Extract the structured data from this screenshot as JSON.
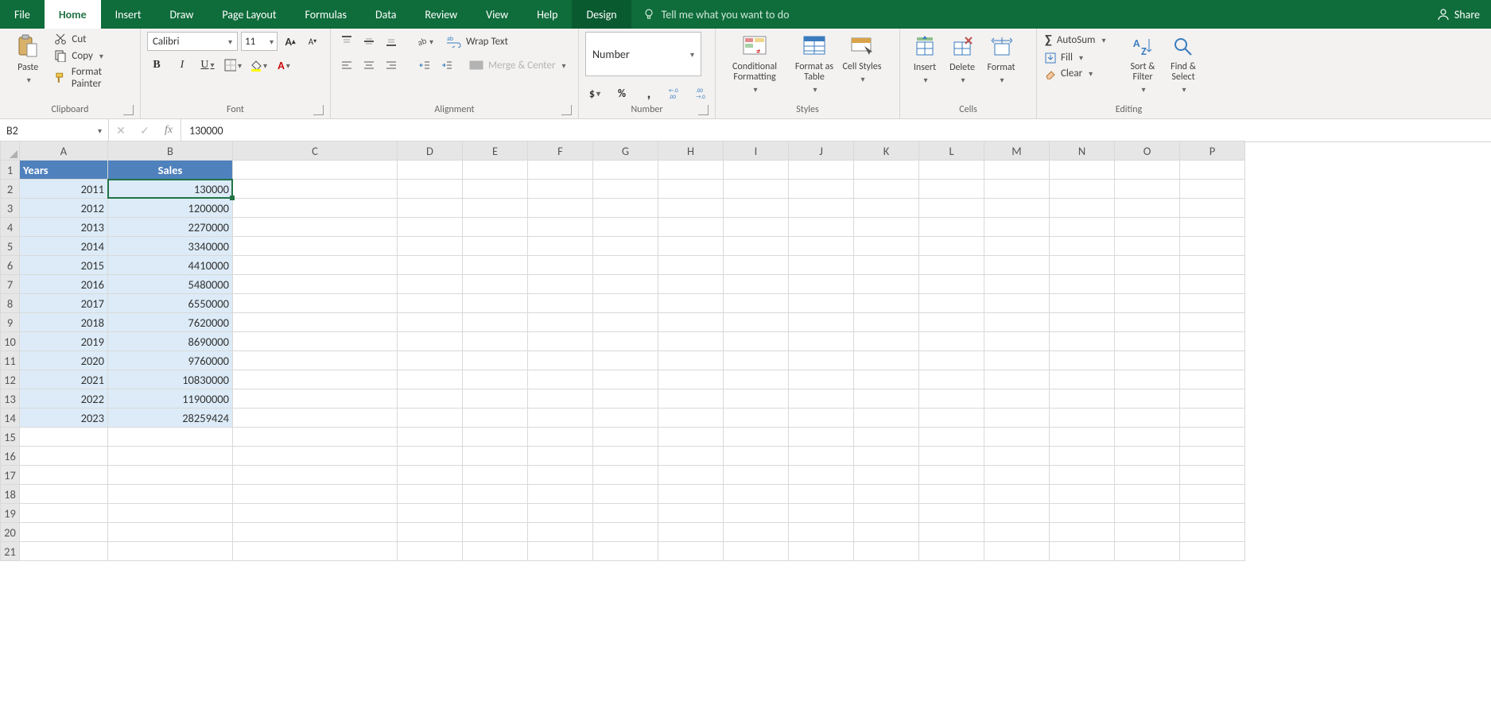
{
  "tabs": {
    "file": "File",
    "home": "Home",
    "insert": "Insert",
    "draw": "Draw",
    "page_layout": "Page Layout",
    "formulas": "Formulas",
    "data": "Data",
    "review": "Review",
    "view": "View",
    "help": "Help",
    "design": "Design"
  },
  "tellme": "Tell me what you want to do",
  "share": "Share",
  "ribbon": {
    "clipboard": {
      "title": "Clipboard",
      "paste": "Paste",
      "cut": "Cut",
      "copy": "Copy",
      "format_painter": "Format Painter"
    },
    "font": {
      "title": "Font",
      "name": "Calibri",
      "size": "11",
      "bold": "B",
      "italic": "I",
      "underline": "U"
    },
    "alignment": {
      "title": "Alignment",
      "wrap": "Wrap Text",
      "merge": "Merge & Center"
    },
    "number": {
      "title": "Number",
      "format": "Number",
      "currency": "$",
      "percent": "%",
      "comma": ",",
      "inc": "+.0",
      "dec": ".00"
    },
    "styles": {
      "title": "Styles",
      "cond": "Conditional Formatting",
      "table": "Format as Table",
      "cell": "Cell Styles"
    },
    "cells": {
      "title": "Cells",
      "insert": "Insert",
      "delete": "Delete",
      "format": "Format"
    },
    "editing": {
      "title": "Editing",
      "autosum": "AutoSum",
      "fill": "Fill",
      "clear": "Clear",
      "sort": "Sort & Filter",
      "find": "Find & Select"
    }
  },
  "formula_bar": {
    "cell_ref": "B2",
    "value": "130000"
  },
  "columns": [
    "A",
    "B",
    "C",
    "D",
    "E",
    "F",
    "G",
    "H",
    "I",
    "J",
    "K",
    "L",
    "M",
    "N",
    "O",
    "P"
  ],
  "row_count": 21,
  "headers": {
    "A": "Years",
    "B": "Sales"
  },
  "data_rows": [
    {
      "year": "2011",
      "sales": "130000"
    },
    {
      "year": "2012",
      "sales": "1200000"
    },
    {
      "year": "2013",
      "sales": "2270000"
    },
    {
      "year": "2014",
      "sales": "3340000"
    },
    {
      "year": "2015",
      "sales": "4410000"
    },
    {
      "year": "2016",
      "sales": "5480000"
    },
    {
      "year": "2017",
      "sales": "6550000"
    },
    {
      "year": "2018",
      "sales": "7620000"
    },
    {
      "year": "2019",
      "sales": "8690000"
    },
    {
      "year": "2020",
      "sales": "9760000"
    },
    {
      "year": "2021",
      "sales": "10830000"
    },
    {
      "year": "2022",
      "sales": "11900000"
    },
    {
      "year": "2023",
      "sales": "28259424"
    }
  ],
  "selection": {
    "col": "B",
    "row": 2
  }
}
